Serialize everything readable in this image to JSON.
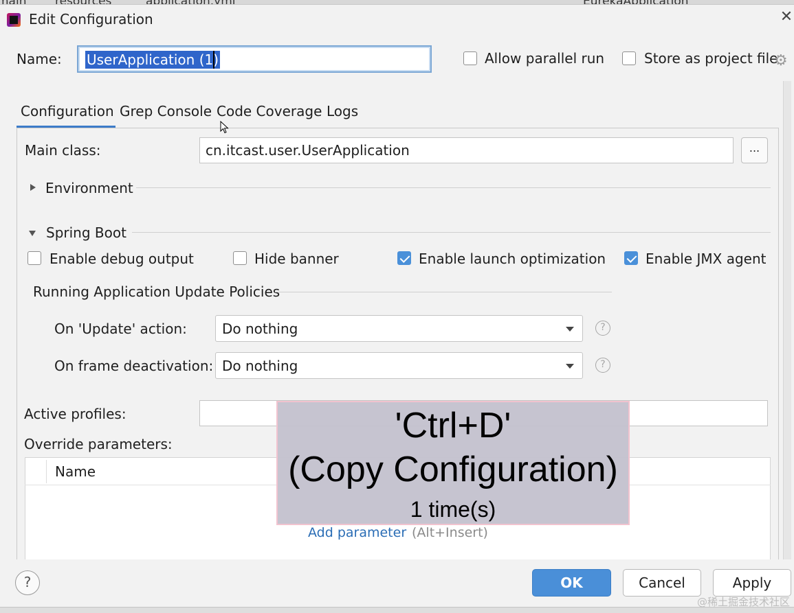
{
  "background_strip": {
    "items": [
      "main",
      "resources",
      "application.yml",
      "EurekaApplication"
    ]
  },
  "dialog": {
    "title": "Edit Configuration",
    "close_glyph": "✕",
    "icon": "intellij-idea-icon"
  },
  "name_row": {
    "label": "Name:",
    "value": "UserApplication (1)",
    "allow_parallel_run": {
      "label": "Allow parallel run",
      "checked": false
    },
    "store_as_project_file": {
      "label": "Store as project file",
      "checked": false
    },
    "gear_icon": "gear-icon"
  },
  "tabs": [
    {
      "label": "Configuration",
      "active": true
    },
    {
      "label": "Grep Console",
      "active": false
    },
    {
      "label": "Code Coverage",
      "active": false
    },
    {
      "label": "Logs",
      "active": false
    }
  ],
  "configuration": {
    "main_class": {
      "label": "Main class:",
      "value": "cn.itcast.user.UserApplication",
      "browse_label": "..."
    },
    "environment": {
      "label": "Environment",
      "expanded": false
    },
    "spring_boot": {
      "label": "Spring Boot",
      "expanded": true,
      "options": [
        {
          "label": "Enable debug output",
          "checked": false
        },
        {
          "label": "Hide banner",
          "checked": false
        },
        {
          "label": "Enable launch optimization",
          "checked": true
        },
        {
          "label": "Enable JMX agent",
          "checked": true
        }
      ]
    },
    "update_policies": {
      "title": "Running Application Update Policies",
      "on_update": {
        "label": "On 'Update' action:",
        "value": "Do nothing"
      },
      "on_frame_deactivation": {
        "label": "On frame deactivation:",
        "value": "Do nothing"
      },
      "help_glyph": "?"
    },
    "active_profiles": {
      "label": "Active profiles:",
      "value": ""
    },
    "override_parameters": {
      "label": "Override parameters:",
      "columns": [
        "Name"
      ],
      "rows": [],
      "add_link": "Add parameter",
      "add_hint": "(Alt+Insert)"
    }
  },
  "shortcut_overlay": {
    "line1": "'Ctrl+D'",
    "line2": "(Copy Configuration)",
    "line3": "1 time(s)"
  },
  "buttons": {
    "help": "?",
    "ok": "OK",
    "cancel": "Cancel",
    "apply": "Apply"
  },
  "watermark": "@稀土掘金技术社区",
  "colors": {
    "accent": "#4a8fd8",
    "selection": "#2f65ca",
    "link": "#2a6db5",
    "overlay_bg": "#c4c2ce"
  }
}
